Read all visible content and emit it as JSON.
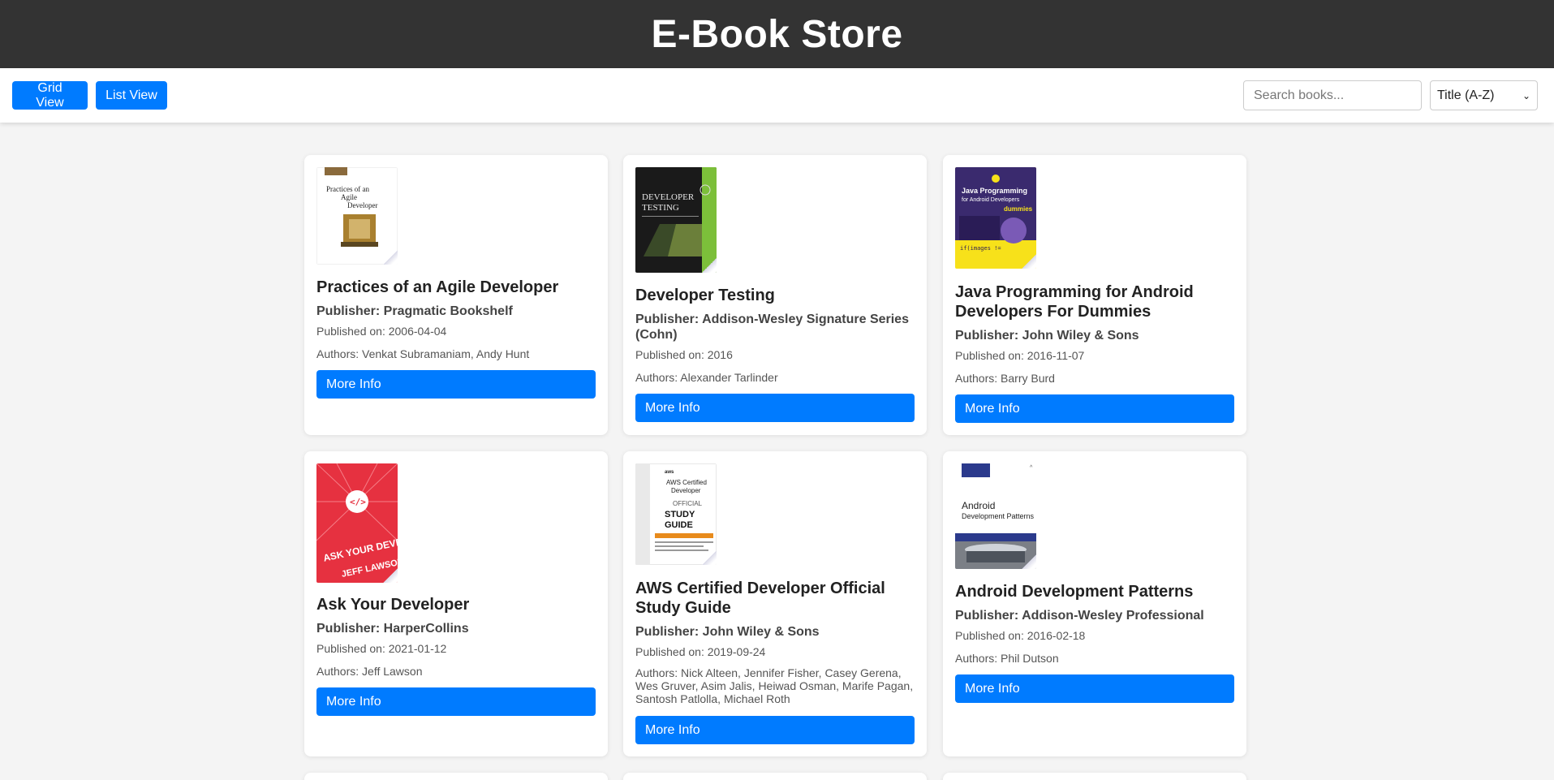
{
  "header": {
    "title": "E-Book Store"
  },
  "toolbar": {
    "grid_view_label": "Grid View",
    "list_view_label": "List View",
    "search_placeholder": "Search books...",
    "sort_selected": "Title (A-Z)"
  },
  "colors": {
    "header_bg": "#333333",
    "accent": "#007bff",
    "page_bg": "#f4f4f4",
    "card_bg": "#ffffff"
  },
  "books": [
    {
      "title": "Practices of an Agile Developer",
      "publisher": "Publisher: Pragmatic Bookshelf",
      "published": "Published on: 2006-04-04",
      "authors": "Authors: Venkat Subramaniam, Andy Hunt",
      "button": "More Info",
      "cover_text": "Practices of an Agile Developer"
    },
    {
      "title": "Developer Testing",
      "publisher": "Publisher: Addison-Wesley Signature Series (Cohn)",
      "published": "Published on: 2016",
      "authors": "Authors: Alexander Tarlinder",
      "button": "More Info",
      "cover_text": "DEVELOPER TESTING"
    },
    {
      "title": "Java Programming for Android Developers For Dummies",
      "publisher": "Publisher: John Wiley & Sons",
      "published": "Published on: 2016-11-07",
      "authors": "Authors: Barry Burd",
      "button": "More Info",
      "cover_text": "Java Programming for Android Developers"
    },
    {
      "title": "Ask Your Developer",
      "publisher": "Publisher: HarperCollins",
      "published": "Published on: 2021-01-12",
      "authors": "Authors: Jeff Lawson",
      "button": "More Info",
      "cover_text": "ASK YOUR DEVELOPER"
    },
    {
      "title": "AWS Certified Developer Official Study Guide",
      "publisher": "Publisher: John Wiley & Sons",
      "published": "Published on: 2019-09-24",
      "authors": "Authors: Nick Alteen, Jennifer Fisher, Casey Gerena, Wes Gruver, Asim Jalis, Heiwad Osman, Marife Pagan, Santosh Patlolla, Michael Roth",
      "button": "More Info",
      "cover_text": "STUDY GUIDE"
    },
    {
      "title": "Android Development Patterns",
      "publisher": "Publisher: Addison-Wesley Professional",
      "published": "Published on: 2016-02-18",
      "authors": "Authors: Phil Dutson",
      "button": "More Info",
      "cover_text": "Android Development Patterns"
    }
  ]
}
